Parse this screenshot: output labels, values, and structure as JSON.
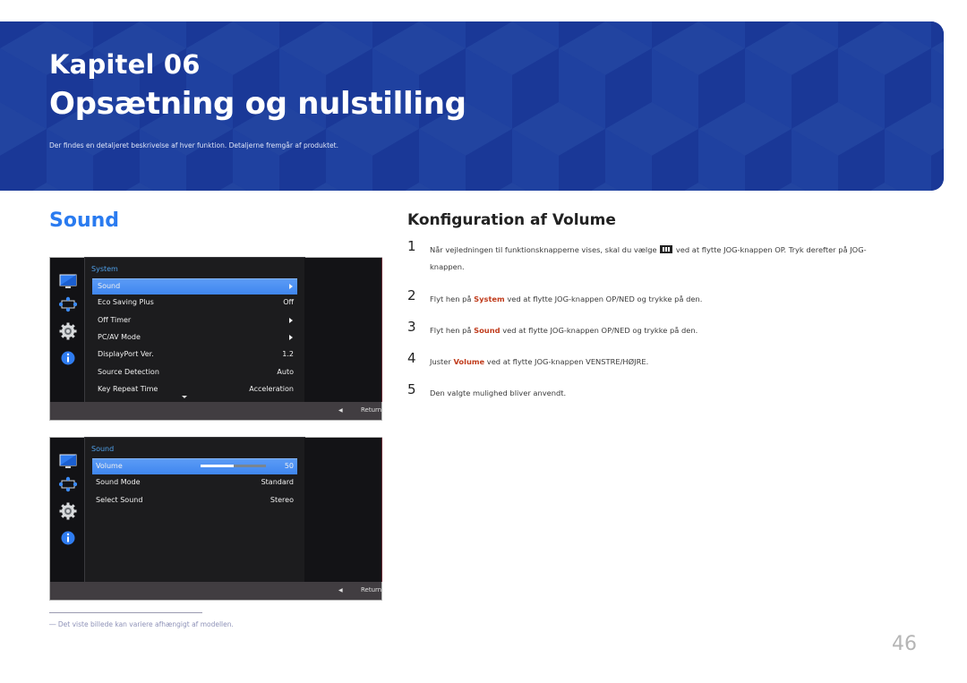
{
  "banner": {
    "chapter": "Kapitel 06",
    "title": "Opsætning og nulstilling",
    "description": "Der findes en detaljeret beskrivelse af hver funktion. Detaljerne fremgår af produktet.",
    "color": "#1e3e9c"
  },
  "section_title": "Sound",
  "osd_system": {
    "rail_icons": [
      "monitor-icon",
      "resize-arrows-icon",
      "gear-icon",
      "info-icon"
    ],
    "panel_title": "System",
    "rows": [
      {
        "label": "Sound",
        "value": "",
        "submenu": true,
        "selected": true
      },
      {
        "label": "Eco Saving Plus",
        "value": "Off",
        "submenu": false,
        "selected": false
      },
      {
        "label": "Off Timer",
        "value": "",
        "submenu": true,
        "selected": false
      },
      {
        "label": "PC/AV Mode",
        "value": "",
        "submenu": true,
        "selected": false
      },
      {
        "label": "DisplayPort Ver.",
        "value": "1.2",
        "submenu": false,
        "selected": false
      },
      {
        "label": "Source Detection",
        "value": "Auto",
        "submenu": false,
        "selected": false
      },
      {
        "label": "Key Repeat Time",
        "value": "Acceleration",
        "submenu": false,
        "selected": false
      }
    ],
    "return_label": "Return"
  },
  "osd_sound": {
    "rail_icons": [
      "monitor-icon",
      "resize-arrows-icon",
      "gear-icon",
      "info-icon"
    ],
    "panel_title": "Sound",
    "rows": [
      {
        "label": "Volume",
        "value": "50",
        "selected": true
      },
      {
        "label": "Sound Mode",
        "value": "Standard",
        "selected": false
      },
      {
        "label": "Select Sound",
        "value": "Stereo",
        "selected": false
      }
    ],
    "volume_fraction": 0.5,
    "return_label": "Return"
  },
  "steps": {
    "heading": "Konfiguration af Volume",
    "items": [
      {
        "num": "1",
        "before": "Når vejledningen til funktionsknapperne vises, skal du vælge",
        "after": "ved at flytte JOG-knappen OP. Tryk derefter på JOG-",
        "line2": "knappen."
      },
      {
        "num": "2",
        "pre": "Flyt hen på ",
        "hl": "System",
        "post": " ved at flytte JOG-knappen OP/NED og trykke på den."
      },
      {
        "num": "3",
        "pre": "Flyt hen på ",
        "hl": "Sound",
        "post": " ved at flytte JOG-knappen OP/NED og trykke på den."
      },
      {
        "num": "4",
        "pre": "Juster ",
        "hl": "Volume",
        "post": " ved at flytte JOG-knappen VENSTRE/HØJRE."
      },
      {
        "num": "5",
        "pre": "Den valgte mulighed bliver anvendt.",
        "hl": "",
        "post": ""
      }
    ],
    "highlight_color": "#c03c1c"
  },
  "footnote": "―  Det viste billede kan variere afhængigt af modellen.",
  "page_number": "46"
}
